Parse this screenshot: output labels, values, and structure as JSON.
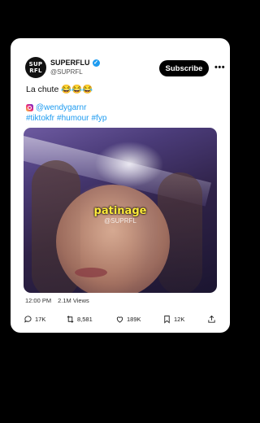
{
  "account": {
    "avatar_text": "SUPRFL",
    "name": "SUPERFLU",
    "handle": "@SUPRFL",
    "verified": true
  },
  "header": {
    "subscribe_label": "Subscribe",
    "more_label": "•••"
  },
  "post": {
    "text": "La chute 😂😂😂",
    "instagram_handle": "@wendygarnr",
    "hashtags": [
      "#tiktokfr",
      "#humour",
      "#fyp"
    ],
    "media_overlay_word": "patinage",
    "media_overlay_handle": "@SUPRFL",
    "time": "12:00 PM",
    "views": "2.1M Views"
  },
  "actions": {
    "replies": "17K",
    "reposts": "8,581",
    "likes": "189K",
    "bookmarks": "12K"
  },
  "colors": {
    "link": "#1d9bf0",
    "verified": "#1d9bf0",
    "overlay_text": "#ffeb3b"
  }
}
